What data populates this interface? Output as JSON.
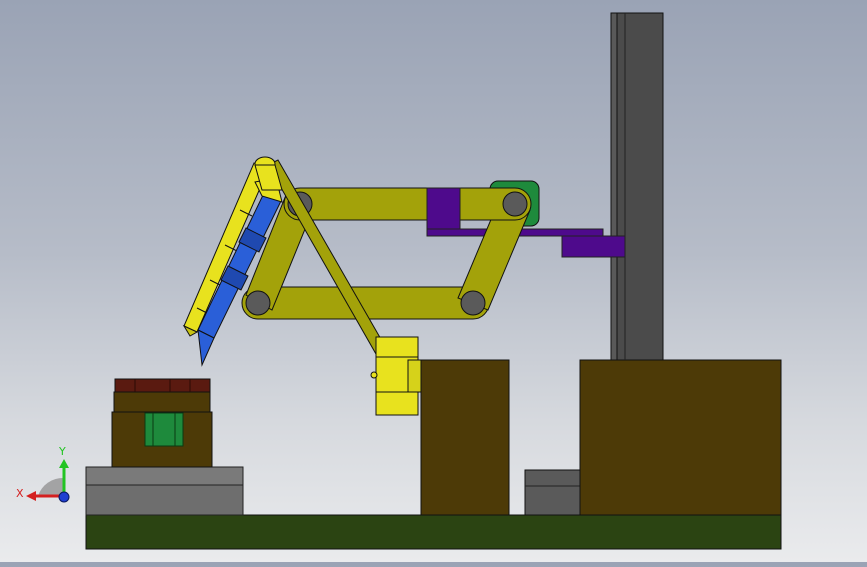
{
  "viewport": {
    "title": "",
    "background_top": "#9aa3b5",
    "background_bottom": "#eaebed"
  },
  "triad": {
    "x_label": "X",
    "y_label": "Y",
    "x_color": "#d42020",
    "y_color": "#22c422",
    "z_color": "#1f3fd0"
  },
  "colors": {
    "arm_yellow": "#a3a20a",
    "bright_yellow": "#e8e21e",
    "purple": "#4e0a8c",
    "green_block": "#1e8a3c",
    "dark_green_base": "#2b4412",
    "olive_block": "#4d3a07",
    "column_gray": "#4b4b4b",
    "blue_tool": "#2a5fd8",
    "steel_gray": "#6e6e6e"
  }
}
